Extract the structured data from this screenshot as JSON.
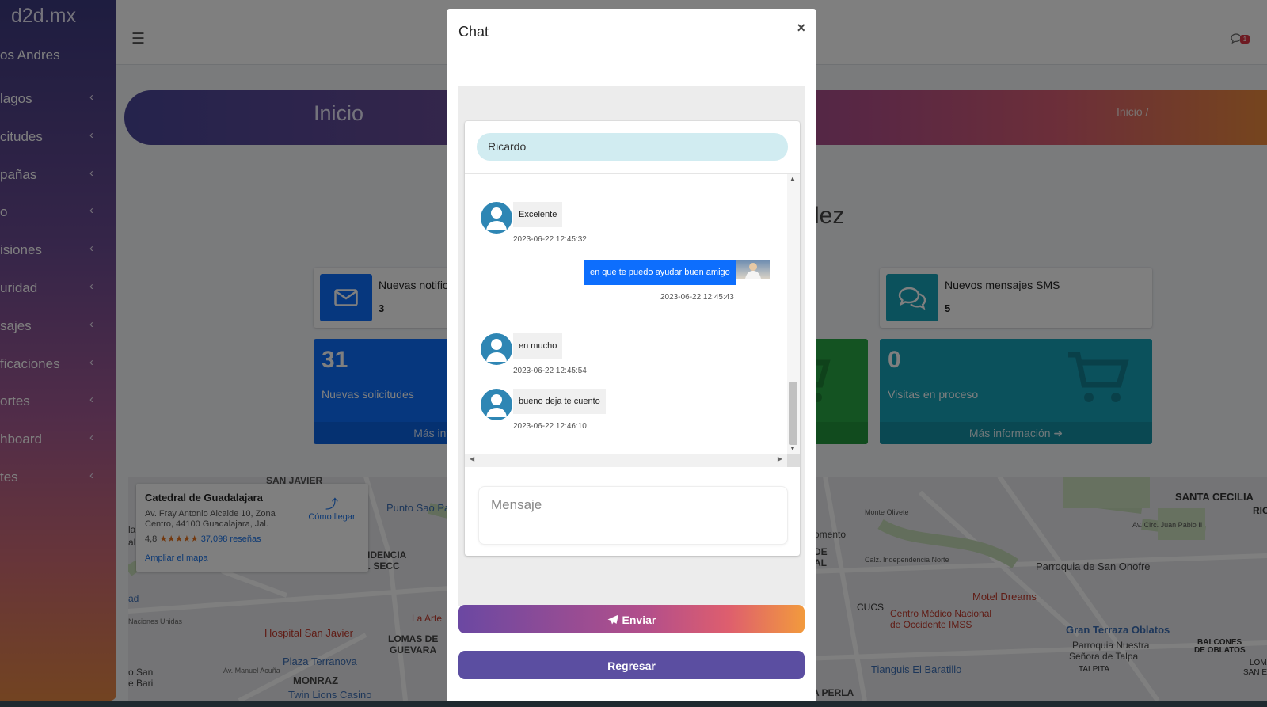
{
  "sidebar": {
    "brand": "d2d.mx",
    "user": "os Andres",
    "items": [
      {
        "label": "lagos"
      },
      {
        "label": "citudes"
      },
      {
        "label": "pañas"
      },
      {
        "label": "o"
      },
      {
        "label": "isiones"
      },
      {
        "label": "uridad"
      },
      {
        "label": "sajes"
      },
      {
        "label": "ficaciones"
      },
      {
        "label": "ortes"
      },
      {
        "label": "hboard"
      },
      {
        "label": "tes"
      }
    ],
    "chevron": "‹"
  },
  "navbar": {
    "badge": "1"
  },
  "header": {
    "title": "Inicio",
    "breadcrumb": "Inicio /"
  },
  "welcome_fragment": "lez",
  "info_boxes": [
    {
      "label": "Nuevas notific",
      "value": "3",
      "icon": "envelope-icon",
      "color": "#0d6efd"
    },
    {
      "label": "Nuevos mensajes SMS",
      "value": "5",
      "icon": "comments-icon",
      "color": "#17a2b8"
    }
  ],
  "small_boxes": [
    {
      "number": "31",
      "label": "Nuevas solicitudes",
      "footer": "Más infor",
      "color": "#0d6efd"
    },
    {
      "number": "0",
      "label": "Visitas en proceso",
      "footer": "Más información",
      "color": "#17a2b8"
    }
  ],
  "map": {
    "place_title": "Catedral de Guadalajara",
    "address": "Av. Fray Antonio Alcalde 10, Zona Centro, 44100 Guadalajara, Jal.",
    "rating": "4,8",
    "stars": "★★★★★",
    "reviews": "37,098 reseñas",
    "directions": "Cómo llegar",
    "enlarge": "Ampliar el mapa",
    "labels": [
      "SAN JAVIER",
      "Punto Sao Pa",
      "VIDENCIA",
      "A. SECC",
      "Hospital San Javier",
      "La Arte",
      "LOMAS DE",
      "GUEVARA",
      "Plaza Terranova",
      "MONRAZ",
      "Twin Lions Casino",
      "Av. Manuel Acuña",
      "Naciones Unidas",
      "o San",
      "e Bari",
      "ad",
      "la",
      "al",
      "SANTA CECILIA",
      "RIO",
      "Parroquia de San Onofre",
      "Motel Dreams",
      "CUCS",
      "Centro Médico Nacional",
      "de Occidente IMSS",
      "Gran Terraza Oblatos",
      "Parroquia Nuestra",
      "Señora de Talpa",
      "TALPITA",
      "BALCONES",
      "DE OBLATOS",
      "LOMAS",
      "SAN EU",
      "Tianguis El Baratillo",
      "A PERLA",
      "omento",
      "DE",
      "AL",
      "Monte Olivete",
      "Calz. Independencia Norte",
      "Av. Circ. Juan Pablo II"
    ]
  },
  "chat": {
    "title": "Chat",
    "close": "×",
    "contact": "Ricardo",
    "messages": [
      {
        "dir": "in",
        "text": "Excelente",
        "time": "2023-06-22 12:45:32"
      },
      {
        "dir": "out",
        "text": "en que te puedo ayudar buen amigo",
        "time": "2023-06-22 12:45:43"
      },
      {
        "dir": "in",
        "text": "en mucho",
        "time": "2023-06-22 12:45:54"
      },
      {
        "dir": "in",
        "text": "bueno deja te cuento",
        "time": "2023-06-22 12:46:10"
      }
    ],
    "input_placeholder": "Mensaje",
    "send_label": "Enviar",
    "back_label": "Regresar"
  }
}
